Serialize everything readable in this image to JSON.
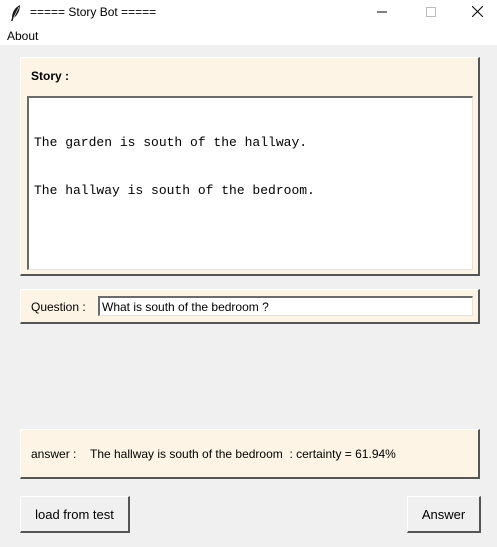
{
  "window": {
    "title": "===== Story Bot =====",
    "icon": "feather-icon"
  },
  "menubar": {
    "items": [
      "About"
    ]
  },
  "story": {
    "label": "Story :",
    "lines": [
      "The garden is south of the hallway.",
      "The hallway is south of the bedroom."
    ]
  },
  "question": {
    "label": "Question :",
    "value": "What is south of the bedroom ?"
  },
  "answer": {
    "label": "answer :",
    "value": "The hallway is south of the bedroom  : certainty = 61.94%"
  },
  "buttons": {
    "load_label": "load from test",
    "answer_label": "Answer"
  },
  "colors": {
    "panel_bg": "#fdf4e6",
    "window_bg": "#f0f0f0"
  }
}
